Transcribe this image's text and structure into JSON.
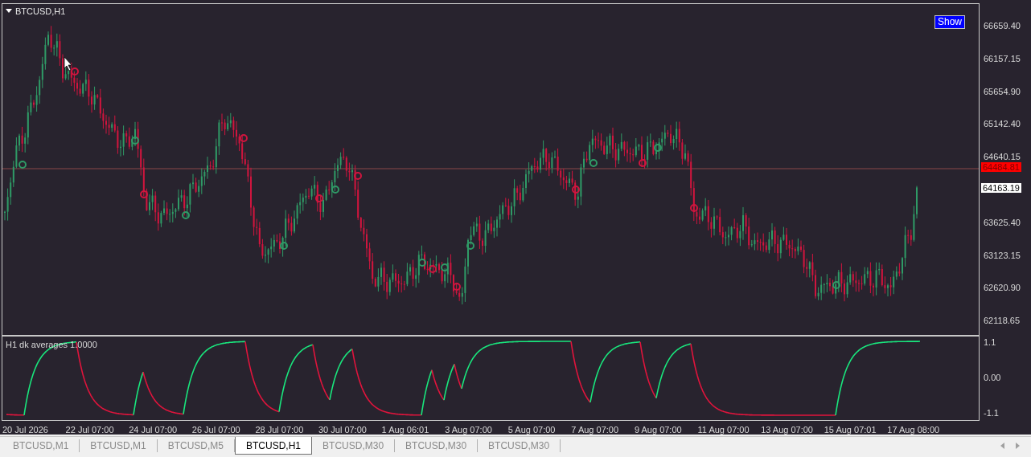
{
  "chart": {
    "title": "BTCUSD,H1",
    "show_button": "Show",
    "price_axis": [
      "66659.40",
      "66157.15",
      "65654.90",
      "65142.40",
      "64640.15",
      "63625.40",
      "63123.15",
      "62620.90",
      "62118.65"
    ],
    "bid_price": "64484.81",
    "last_price": "64163.19"
  },
  "indicator": {
    "label": "H1 dk averages 1.0000",
    "axis": [
      "1.1",
      "0.00",
      "-1.1"
    ]
  },
  "time_axis": [
    "20 Jul 2026",
    "22 Jul 07:00",
    "24 Jul 07:00",
    "26 Jul 07:00",
    "28 Jul 07:00",
    "30 Jul 07:00",
    "1 Aug 06:01",
    "3 Aug 07:00",
    "5 Aug 07:00",
    "7 Aug 07:00",
    "9 Aug 07:00",
    "11 Aug 07:00",
    "13 Aug 07:00",
    "15 Aug 07:01",
    "17 Aug 08:00"
  ],
  "tabs": [
    {
      "label": "BTCUSD,M1",
      "selected": false
    },
    {
      "label": "BTCUSD,M1",
      "selected": false
    },
    {
      "label": "BTCUSD,M5",
      "selected": false
    },
    {
      "label": "BTCUSD,H1",
      "selected": true
    },
    {
      "label": "BTCUSD,M30",
      "selected": false
    },
    {
      "label": "BTCUSD,M30",
      "selected": false
    },
    {
      "label": "BTCUSD,M30",
      "selected": false
    }
  ]
}
